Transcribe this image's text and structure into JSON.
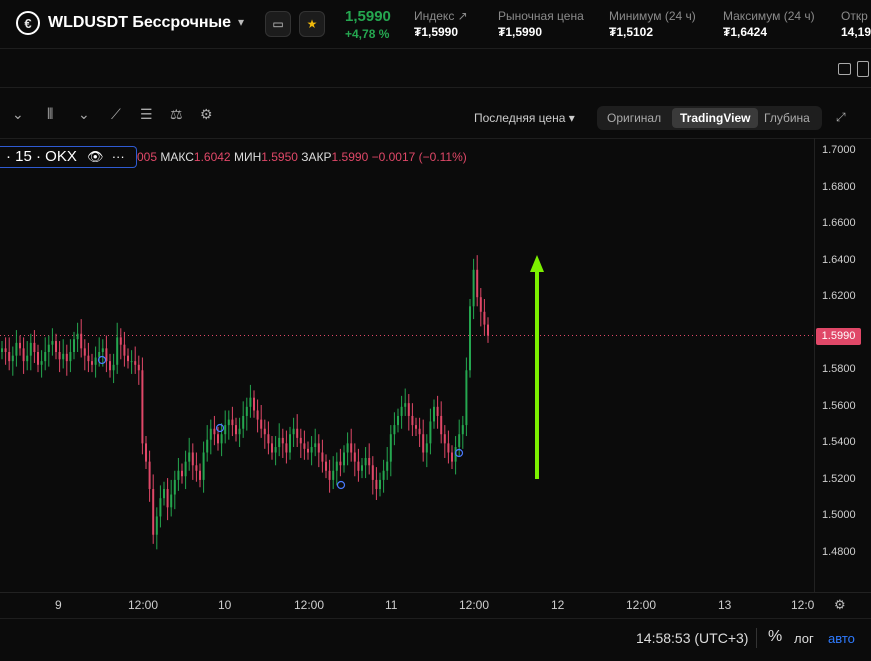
{
  "header": {
    "logo_glyph": "€",
    "pair_title": "WLDUSDT Бессрочные",
    "book_icon": "book-icon",
    "star_icon": "star-icon",
    "last_price": "1,5990",
    "change": "+4,78 %",
    "stats": [
      {
        "label": "Индекс ↗",
        "value": "₮1,5990"
      },
      {
        "label": "Рыночная цена",
        "value": "₮1,5990"
      },
      {
        "label": "Минимум (24 ч)",
        "value": "₮1,5102"
      },
      {
        "label": "Максимум (24 ч)",
        "value": "₮1,6424"
      },
      {
        "label": "Откр",
        "value": "14,19"
      }
    ]
  },
  "toolbar": {
    "price_type": "Последняя цена",
    "views": [
      "Оригинал",
      "TradingView",
      "Глубина"
    ],
    "active_view": "TradingView"
  },
  "legend": {
    "series": "· 15 · OKX",
    "open_tail": "005",
    "high_label": "МАКС",
    "high": "1.6042",
    "low_label": "МИН",
    "low": "1.5950",
    "close_label": "ЗАКР",
    "close": "1.5990",
    "delta": "−0.0017 (−0.11%)"
  },
  "colors": {
    "up": "#25a750",
    "down": "#e04868",
    "accent": "#2f7bff",
    "arrow": "#7cf000"
  },
  "chart_data": {
    "type": "candlestick",
    "y_ticks": [
      "1.7000",
      "1.6800",
      "1.6600",
      "1.6400",
      "1.6200",
      "1.5990",
      "1.5800",
      "1.5600",
      "1.5400",
      "1.5200",
      "1.5000",
      "1.4800"
    ],
    "ylim": [
      1.47,
      1.71
    ],
    "current_price": "1.5990",
    "x_ticks": [
      "9",
      "12:00",
      "10",
      "12:00",
      "11",
      "12:00",
      "12",
      "12:00",
      "13",
      "12:0"
    ],
    "annotation": "green upward arrow",
    "series_close": [
      1.592,
      1.59,
      1.585,
      1.588,
      1.595,
      1.592,
      1.585,
      1.588,
      1.595,
      1.59,
      1.583,
      1.585,
      1.59,
      1.594,
      1.596,
      1.59,
      1.586,
      1.589,
      1.585,
      1.59,
      1.597,
      1.6,
      1.592,
      1.588,
      1.585,
      1.583,
      1.587,
      1.59,
      1.592,
      1.585,
      1.58,
      1.583,
      1.598,
      1.594,
      1.588,
      1.585,
      1.585,
      1.583,
      1.58,
      1.54,
      1.53,
      1.515,
      1.49,
      1.5,
      1.51,
      1.515,
      1.505,
      1.512,
      1.52,
      1.525,
      1.522,
      1.53,
      1.535,
      1.528,
      1.525,
      1.52,
      1.535,
      1.542,
      1.548,
      1.545,
      1.54,
      1.545,
      1.55,
      1.553,
      1.55,
      1.545,
      1.548,
      1.555,
      1.56,
      1.565,
      1.558,
      1.553,
      1.548,
      1.545,
      1.54,
      1.535,
      1.538,
      1.543,
      1.54,
      1.535,
      1.545,
      1.548,
      1.543,
      1.54,
      1.537,
      1.535,
      1.538,
      1.54,
      1.535,
      1.53,
      1.525,
      1.52,
      1.525,
      1.53,
      1.528,
      1.535,
      1.54,
      1.535,
      1.53,
      1.525,
      1.528,
      1.532,
      1.528,
      1.52,
      1.515,
      1.52,
      1.525,
      1.53,
      1.545,
      1.55,
      1.555,
      1.56,
      1.562,
      1.555,
      1.55,
      1.548,
      1.545,
      1.535,
      1.54,
      1.552,
      1.56,
      1.555,
      1.545,
      1.54,
      1.535,
      1.53,
      1.538,
      1.545,
      1.55,
      1.58,
      1.615,
      1.635,
      1.62,
      1.612,
      1.605,
      1.599
    ]
  }
}
